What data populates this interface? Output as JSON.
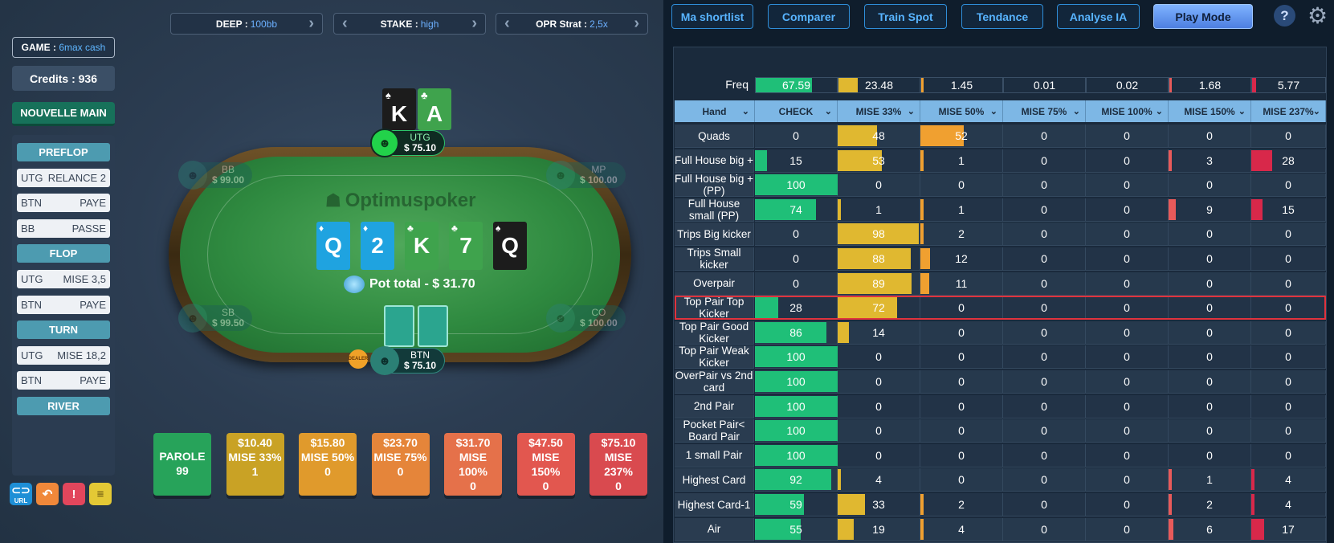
{
  "top_selectors": [
    {
      "label": "DEEP :",
      "value": "100bb"
    },
    {
      "label": "STAKE :",
      "value": "high"
    },
    {
      "label": "OPR Strat :",
      "value": "2,5x"
    }
  ],
  "game": {
    "label": "GAME :",
    "value": "6max cash"
  },
  "credits": "Credits : 936",
  "new_hand": "NOUVELLE MAIN",
  "history": [
    {
      "type": "street",
      "label": "PREFLOP"
    },
    {
      "type": "move",
      "pos": "UTG",
      "action": "RELANCE 2"
    },
    {
      "type": "move",
      "pos": "BTN",
      "action": "PAYE"
    },
    {
      "type": "move",
      "pos": "BB",
      "action": "PASSE"
    },
    {
      "type": "street",
      "label": "FLOP"
    },
    {
      "type": "move",
      "pos": "UTG",
      "action": "MISE 3,5"
    },
    {
      "type": "move",
      "pos": "BTN",
      "action": "PAYE"
    },
    {
      "type": "street",
      "label": "TURN"
    },
    {
      "type": "move",
      "pos": "UTG",
      "action": "MISE 18,2"
    },
    {
      "type": "move",
      "pos": "BTN",
      "action": "PAYE"
    },
    {
      "type": "street",
      "label": "RIVER"
    }
  ],
  "bottom_icons": [
    "link-icon",
    "undo-icon",
    "alert-icon",
    "notes-icon"
  ],
  "bottom_icon_labels": {
    "link": "URL"
  },
  "brand": "Optimuspoker",
  "hero_cards": [
    {
      "rank": "K",
      "suit": "♠",
      "color": "#1c1c1c"
    },
    {
      "rank": "A",
      "suit": "♣",
      "color": "#3fa34d"
    }
  ],
  "board": [
    {
      "rank": "Q",
      "suit": "♦",
      "color": "#1fa3e0"
    },
    {
      "rank": "2",
      "suit": "♦",
      "color": "#1fa3e0"
    },
    {
      "rank": "K",
      "suit": "♣",
      "color": "#3fa34d"
    },
    {
      "rank": "7",
      "suit": "♣",
      "color": "#3fa34d"
    },
    {
      "rank": "Q",
      "suit": "♠",
      "color": "#1c1c1c"
    }
  ],
  "pot": "Pot total - $ 31.70",
  "seats": {
    "utg": {
      "name": "UTG",
      "stack": "$ 75.10"
    },
    "bb": {
      "name": "BB",
      "stack": "$ 99.00"
    },
    "mp": {
      "name": "MP",
      "stack": "$ 100.00"
    },
    "sb": {
      "name": "SB",
      "stack": "$ 99.50"
    },
    "co": {
      "name": "CO",
      "stack": "$ 100.00"
    },
    "btn": {
      "name": "BTN",
      "stack": "$ 75.10"
    }
  },
  "dealer": "DEALER",
  "bet_options": [
    {
      "amount": "",
      "label": "PAROLE",
      "count": "99",
      "color": "#27a35a"
    },
    {
      "amount": "$10.40",
      "label": "MISE 33%",
      "count": "1",
      "color": "#c9a225"
    },
    {
      "amount": "$15.80",
      "label": "MISE 50%",
      "count": "0",
      "color": "#e09a2c"
    },
    {
      "amount": "$23.70",
      "label": "MISE 75%",
      "count": "0",
      "color": "#e5853a"
    },
    {
      "amount": "$31.70",
      "label": "MISE 100%",
      "count": "0",
      "color": "#e5714a"
    },
    {
      "amount": "$47.50",
      "label": "MISE 150%",
      "count": "0",
      "color": "#e2574f"
    },
    {
      "amount": "$75.10",
      "label": "MISE 237%",
      "count": "0",
      "color": "#d94a4f"
    }
  ],
  "toolbar": [
    "Ma shortlist",
    "Comparer",
    "Train Spot",
    "Tendance",
    "Analyse IA"
  ],
  "play_mode": "Play Mode",
  "freq_label": "Freq",
  "freq": [
    "67.59",
    "23.48",
    "1.45",
    "0.01",
    "0.02",
    "1.68",
    "5.77"
  ],
  "freq_values": [
    67.59,
    23.48,
    1.45,
    0.01,
    0.02,
    1.68,
    5.77
  ],
  "columns": [
    "Hand",
    "CHECK",
    "MISE 33%",
    "MISE 50%",
    "MISE 75%",
    "MISE 100%",
    "MISE 150%",
    "MISE 237%"
  ],
  "col_colors": [
    "#1fbf78",
    "#e0b830",
    "#f0a030",
    "#e98a3a",
    "#e2704a",
    "#e85a5a",
    "#d8284a"
  ],
  "rows": [
    {
      "hand": "Quads",
      "v": [
        0,
        48,
        52,
        0,
        0,
        0,
        0
      ]
    },
    {
      "hand": "Full House big +",
      "v": [
        15,
        53,
        1,
        0,
        0,
        3,
        28
      ]
    },
    {
      "hand": "Full House big + (PP)",
      "v": [
        100,
        0,
        0,
        0,
        0,
        0,
        0
      ]
    },
    {
      "hand": "Full House small (PP)",
      "v": [
        74,
        1,
        1,
        0,
        0,
        9,
        15
      ]
    },
    {
      "hand": "Trips Big kicker",
      "v": [
        0,
        98,
        2,
        0,
        0,
        0,
        0
      ]
    },
    {
      "hand": "Trips Small kicker",
      "v": [
        0,
        88,
        12,
        0,
        0,
        0,
        0
      ]
    },
    {
      "hand": "Overpair",
      "v": [
        0,
        89,
        11,
        0,
        0,
        0,
        0
      ]
    },
    {
      "hand": "Top Pair Top Kicker",
      "v": [
        28,
        72,
        0,
        0,
        0,
        0,
        0
      ],
      "highlight": true
    },
    {
      "hand": "Top Pair Good Kicker",
      "v": [
        86,
        14,
        0,
        0,
        0,
        0,
        0
      ]
    },
    {
      "hand": "Top Pair Weak Kicker",
      "v": [
        100,
        0,
        0,
        0,
        0,
        0,
        0
      ]
    },
    {
      "hand": "OverPair vs 2nd card",
      "v": [
        100,
        0,
        0,
        0,
        0,
        0,
        0
      ]
    },
    {
      "hand": "2nd Pair",
      "v": [
        100,
        0,
        0,
        0,
        0,
        0,
        0
      ]
    },
    {
      "hand": "Pocket Pair< Board Pair",
      "v": [
        100,
        0,
        0,
        0,
        0,
        0,
        0
      ]
    },
    {
      "hand": "1 small Pair",
      "v": [
        100,
        0,
        0,
        0,
        0,
        0,
        0
      ]
    },
    {
      "hand": "Highest Card",
      "v": [
        92,
        4,
        0,
        0,
        0,
        1,
        4
      ]
    },
    {
      "hand": "Highest Card-1",
      "v": [
        59,
        33,
        2,
        0,
        0,
        2,
        4
      ]
    },
    {
      "hand": "Air",
      "v": [
        55,
        19,
        4,
        0,
        0,
        6,
        17
      ]
    }
  ]
}
